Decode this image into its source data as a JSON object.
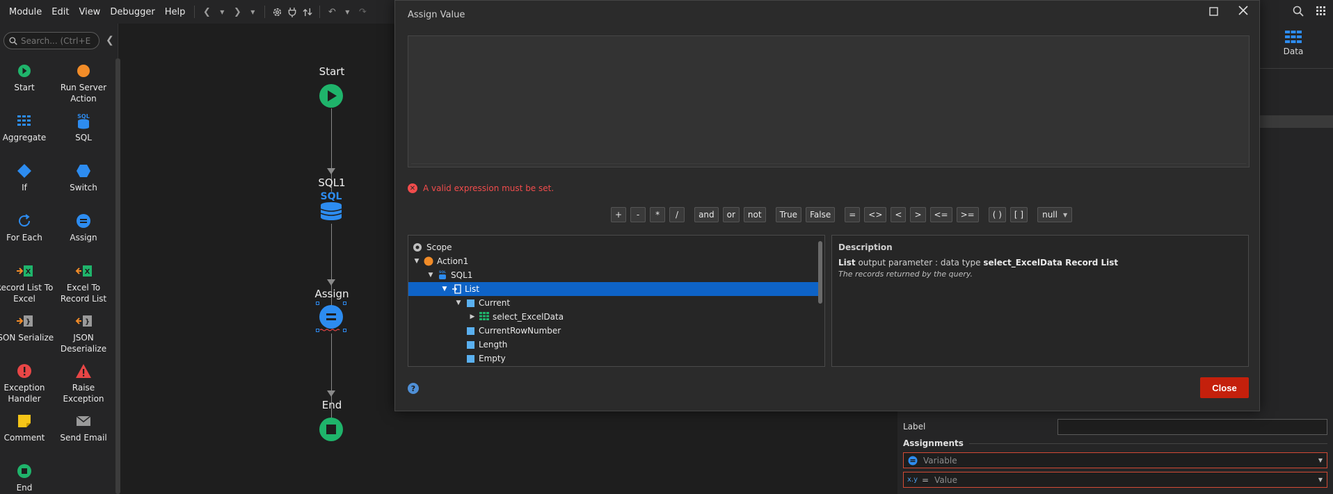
{
  "menu": [
    "Module",
    "Edit",
    "View",
    "Debugger",
    "Help"
  ],
  "toolbar_icons": [
    "back-icon",
    "dropdown-icon",
    "forward-icon",
    "dropdown-icon",
    "settings-icon",
    "plug-icon",
    "publish-icon",
    "undo-icon",
    "dropdown-icon",
    "redo-icon"
  ],
  "toolbox": {
    "search_placeholder": "Search... (Ctrl+E)",
    "tools": [
      {
        "label": "Start",
        "icon": "start-icon"
      },
      {
        "label": "Run Server Action",
        "icon": "run-server-action-icon"
      },
      {
        "label": "Aggregate",
        "icon": "aggregate-icon"
      },
      {
        "label": "SQL",
        "icon": "sql-icon"
      },
      {
        "label": "If",
        "icon": "if-icon"
      },
      {
        "label": "Switch",
        "icon": "switch-icon"
      },
      {
        "label": "For Each",
        "icon": "for-each-icon"
      },
      {
        "label": "Assign",
        "icon": "assign-icon"
      },
      {
        "label": "Record List To Excel",
        "icon": "record-list-to-excel-icon"
      },
      {
        "label": "Excel To Record List",
        "icon": "excel-to-record-list-icon"
      },
      {
        "label": "JSON Serialize",
        "icon": "json-serialize-icon"
      },
      {
        "label": "JSON Deserialize",
        "icon": "json-deserialize-icon"
      },
      {
        "label": "Exception Handler",
        "icon": "exception-handler-icon"
      },
      {
        "label": "Raise Exception",
        "icon": "raise-exception-icon"
      },
      {
        "label": "Comment",
        "icon": "comment-icon"
      },
      {
        "label": "Send Email",
        "icon": "send-email-icon"
      },
      {
        "label": "End",
        "icon": "end-icon"
      }
    ]
  },
  "flow": {
    "start": "Start",
    "sql": "SQL1",
    "sql_badge": "SQL",
    "assign": "Assign",
    "end": "End"
  },
  "right_panel": {
    "data_tab": "Data",
    "label_field": "Label",
    "assignments_heading": "Assignments",
    "variable_placeholder": "Variable",
    "value_placeholder": "Value",
    "value_prefix": "x.y",
    "value_equals": "="
  },
  "dialog": {
    "title": "Assign Value",
    "error": "A valid expression must be set.",
    "operators": [
      "+",
      "-",
      "*",
      "/",
      "and",
      "or",
      "not",
      "True",
      "False",
      "=",
      "<>",
      "<",
      ">",
      "<=",
      ">=",
      "( )",
      "[ ]",
      "null"
    ],
    "tree": [
      {
        "label": "Scope",
        "level": 0,
        "icon": "scope-icon",
        "caret": ""
      },
      {
        "label": "Action1",
        "level": 1,
        "icon": "action-icon",
        "caret": "down"
      },
      {
        "label": "SQL1",
        "level": 2,
        "icon": "sql-icon",
        "caret": "down"
      },
      {
        "label": "List",
        "level": 3,
        "icon": "list-output-icon",
        "caret": "down",
        "selected": true
      },
      {
        "label": "Current",
        "level": 4,
        "icon": "attribute-icon",
        "caret": "down"
      },
      {
        "label": "select_ExcelData",
        "level": 5,
        "icon": "structure-icon",
        "caret": "right"
      },
      {
        "label": "CurrentRowNumber",
        "level": 4,
        "icon": "attribute-icon",
        "caret": ""
      },
      {
        "label": "Length",
        "level": 4,
        "icon": "attribute-icon",
        "caret": ""
      },
      {
        "label": "Empty",
        "level": 4,
        "icon": "attribute-icon",
        "caret": ""
      }
    ],
    "description": {
      "heading": "Description",
      "name": "List",
      "text1": " output parameter : data type ",
      "type": "select_ExcelData Record List",
      "sub": "The records returned by the query."
    },
    "help": "?",
    "close": "Close"
  },
  "colors": {
    "accent_green": "#1fb46b",
    "accent_blue": "#2d8cf0",
    "accent_orange": "#f28c28",
    "error_red": "#f14c4c",
    "close_red": "#c4200c",
    "selection": "#0e63c7"
  }
}
